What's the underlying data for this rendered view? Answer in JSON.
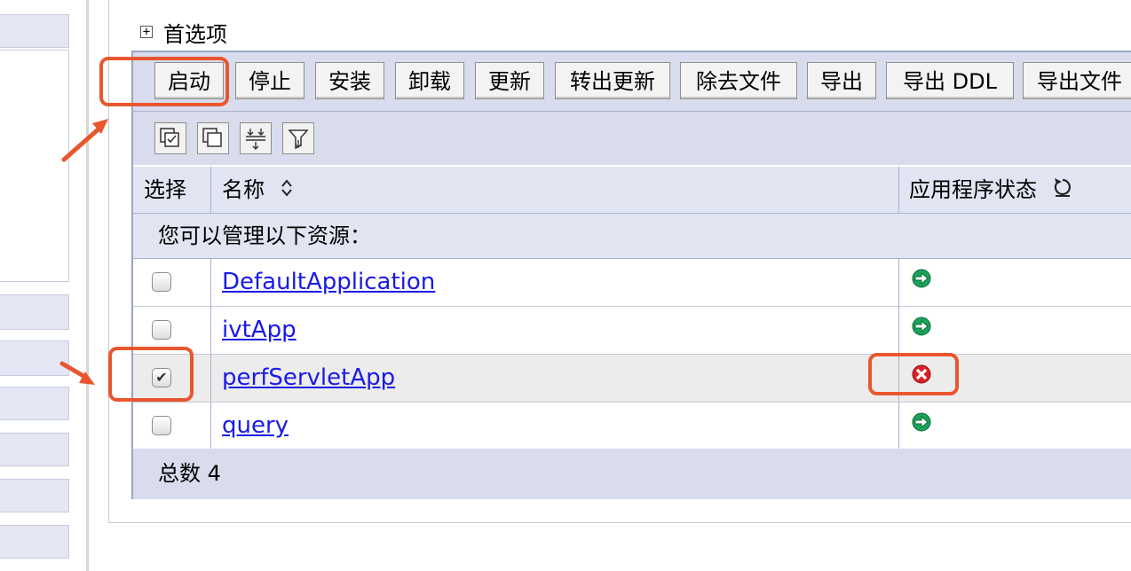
{
  "preferences": {
    "toggle_icon": "plus-box-icon",
    "label": "首选项"
  },
  "toolbar": {
    "buttons": [
      "启动",
      "停止",
      "安装",
      "卸载",
      "更新",
      "转出更新",
      "除去文件",
      "导出",
      "导出 DDL",
      "导出文件"
    ]
  },
  "icon_toolbar": [
    "select-all-icon",
    "deselect-all-icon",
    "show-filter-icon",
    "clear-filter-icon"
  ],
  "table": {
    "columns": {
      "select": "选择",
      "name": "名称",
      "status": "应用程序状态"
    },
    "sort_icon": "sort-icon",
    "refresh_icon": "refresh-icon",
    "subheader": "您可以管理以下资源：",
    "rows": [
      {
        "name": "DefaultApplication",
        "checked": false,
        "status": "started",
        "status_icon": "started-arrow-icon"
      },
      {
        "name": "ivtApp",
        "checked": false,
        "status": "started",
        "status_icon": "started-arrow-icon"
      },
      {
        "name": "perfServletApp",
        "checked": true,
        "status": "stopped",
        "status_icon": "stopped-x-icon"
      },
      {
        "name": "query",
        "checked": false,
        "status": "started",
        "status_icon": "started-arrow-icon"
      }
    ],
    "footer": "总数 4"
  },
  "colors": {
    "accent": "#e9562e",
    "link": "#1a1ae6",
    "started": "#1aa35a",
    "stopped": "#d8232a",
    "header_bg": "#e1e4f1"
  }
}
